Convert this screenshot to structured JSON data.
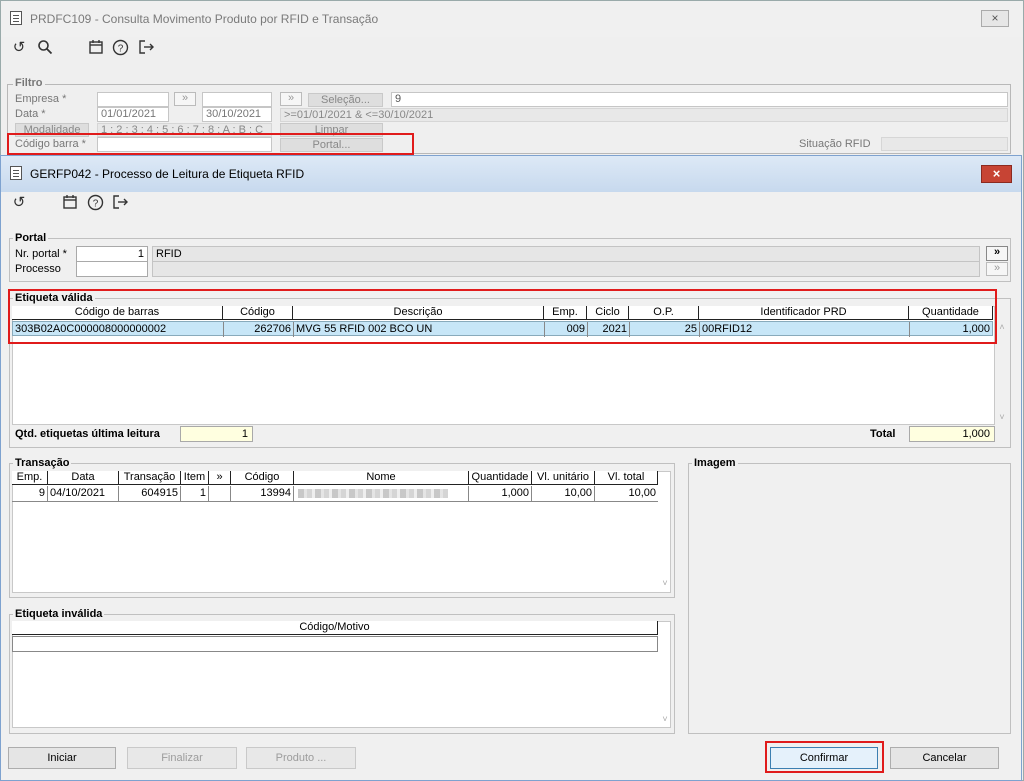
{
  "background_window": {
    "title": "PRDFC109 - Consulta Movimento Produto por RFID e Transação",
    "close_icon": "×",
    "filter": {
      "group_label": "Filtro",
      "empresa_label": "Empresa *",
      "data_label": "Data *",
      "data_inicio": "01/01/2021",
      "data_fim": "30/10/2021",
      "selecao_button": "Seleção...",
      "selecao_value": "9",
      "data_expr": ">=01/01/2021 & <=30/10/2021",
      "modalidade_label": "Modalidade",
      "modalidade_value": "1 : 2 : 3 : 4 : 5 : 6 : 7 : 8 : A : B : C",
      "limpar_button": "Limpar",
      "codigo_barra_label": "Código barra *",
      "portal_button": "Portal...",
      "situacao_rfid_label": "Situação RFID",
      "arrows_icon": "»"
    }
  },
  "dialog": {
    "title": "GERFP042 - Processo de Leitura de Etiqueta RFID",
    "close_icon": "×",
    "toolbar_icons": [
      "undo-icon",
      "calendar-icon",
      "help-icon",
      "exit-icon"
    ],
    "portal": {
      "group_label": "Portal",
      "nr_portal_label": "Nr. portal *",
      "nr_portal_value": "1",
      "nr_portal_desc": "RFID",
      "processo_label": "Processo",
      "processo_value": "",
      "go_icon": "»"
    },
    "etiqueta_valida": {
      "group_label": "Etiqueta válida",
      "columns": [
        "Código de barras",
        "Código",
        "Descrição",
        "Emp.",
        "Ciclo",
        "O.P.",
        "Identificador PRD",
        "Quantidade"
      ],
      "rows": [
        [
          "303B02A0C000008000000002",
          "262706",
          "MVG 55 RFID 002 BCO UN",
          "009",
          "2021",
          "25",
          "00RFID12",
          "1,000"
        ]
      ],
      "qtd_label": "Qtd. etiquetas última leitura",
      "qtd_value": "1",
      "total_label": "Total",
      "total_value": "1,000"
    },
    "transacao": {
      "group_label": "Transação",
      "columns": [
        "Emp.",
        "Data",
        "Transação",
        "Item",
        "»",
        "Código",
        "Nome",
        "Quantidade",
        "Vl. unitário",
        "Vl. total"
      ],
      "rows": [
        [
          "9",
          "04/10/2021",
          "604915",
          "1",
          "",
          "13994",
          "",
          "1,000",
          "10,00",
          "10,00"
        ]
      ]
    },
    "imagem": {
      "group_label": "Imagem"
    },
    "etiqueta_invalida": {
      "group_label": "Etiqueta inválida",
      "columns": [
        "Código/Motivo"
      ]
    },
    "buttons": {
      "iniciar": "Iniciar",
      "finalizar": "Finalizar",
      "produto": "Produto ...",
      "confirmar": "Confirmar",
      "cancelar": "Cancelar"
    }
  }
}
